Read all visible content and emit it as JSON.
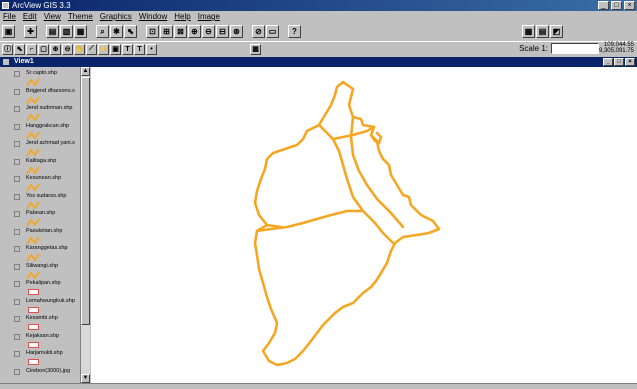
{
  "window": {
    "title": "ArcView GIS 3.3"
  },
  "menu": [
    "File",
    "Edit",
    "View",
    "Theme",
    "Graphics",
    "Window",
    "Help",
    "Image"
  ],
  "toolbar": {
    "scale_label": "Scale 1:",
    "coord_x": "109,044.55",
    "coord_y": "9,305,091.75"
  },
  "view": {
    "title": "View1"
  },
  "themes": [
    {
      "label": "Sr capto.shp",
      "sym": "line"
    },
    {
      "label": "Brigjend dharsono.s",
      "sym": "line"
    },
    {
      "label": "Jend sudirman.shp",
      "sym": "line"
    },
    {
      "label": "Hanggrakcan.shp",
      "sym": "line"
    },
    {
      "label": "Jend achmad yani.s",
      "sym": "line"
    },
    {
      "label": "Kalitaga.shp",
      "sym": "line"
    },
    {
      "label": "Kesunean.shp",
      "sym": "line"
    },
    {
      "label": "Yos sudarso.shp",
      "sym": "line"
    },
    {
      "label": "Pabean.shp",
      "sym": "line"
    },
    {
      "label": "Pasuketan.shp",
      "sym": "line"
    },
    {
      "label": "Karanggetas.shp",
      "sym": "line"
    },
    {
      "label": "Siliwangi.shp",
      "sym": "line"
    },
    {
      "label": "Pekalipan.shp",
      "sym": "poly"
    },
    {
      "label": "Lemahwungkuk.shp",
      "sym": "poly"
    },
    {
      "label": "Kesambi.shp",
      "sym": "poly"
    },
    {
      "label": "Kejaksan.shp",
      "sym": "poly"
    },
    {
      "label": "Harjamukti.shp",
      "sym": "poly"
    },
    {
      "label": "Cirebon(3000).jpg",
      "sym": "none"
    }
  ],
  "colors": {
    "title_blue": "#0a246a",
    "map_outline": "#f5a623",
    "line_symbol": "#f5a623",
    "poly_symbol": "#e05050"
  }
}
